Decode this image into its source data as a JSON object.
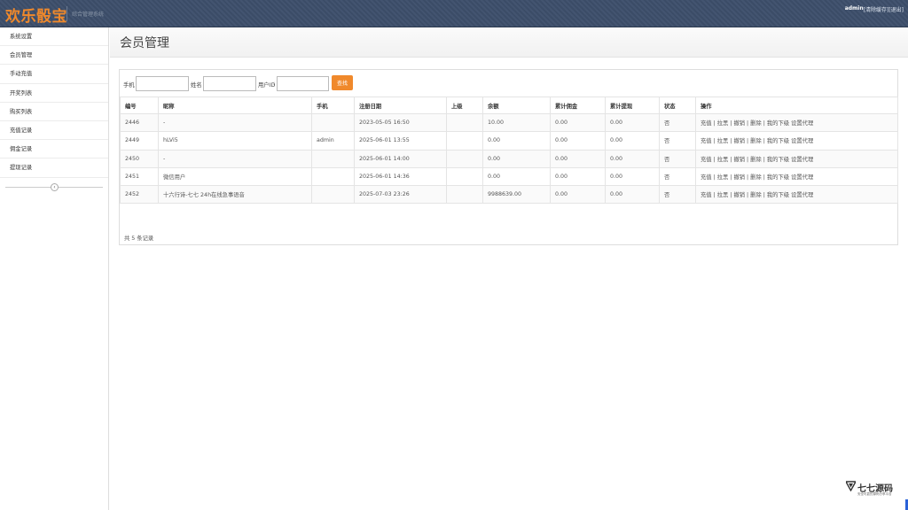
{
  "header": {
    "logo": "欢乐骰宝",
    "subtitle": "综合管理系统",
    "user": "admin",
    "clear_cache": "[清除缓存]",
    "logout": "[退出]"
  },
  "sidebar": {
    "items": [
      {
        "label": "系统设置"
      },
      {
        "label": "会员管理"
      },
      {
        "label": "手动充值"
      },
      {
        "label": "开奖列表"
      },
      {
        "label": "购买列表"
      },
      {
        "label": "充值记录"
      },
      {
        "label": "佣金记录"
      },
      {
        "label": "提现记录"
      }
    ],
    "collapse_icon": "chevron-left-icon"
  },
  "main": {
    "title": "会员管理",
    "search": {
      "phone_label": "手机",
      "name_label": "姓名",
      "uid_label": "用户ID",
      "button_label": "查找",
      "button_color": "#f0892b"
    },
    "table": {
      "headers": [
        "编号",
        "昵称",
        "手机",
        "注册日期",
        "上级",
        "余额",
        "累计佣金",
        "累计提现",
        "状态",
        "操作"
      ],
      "rows": [
        {
          "id": "2446",
          "nick": "-",
          "phone": "",
          "date": "2023-05-05 16:50",
          "parent": "",
          "balance": "10.00",
          "commission": "0.00",
          "withdraw": "0.00",
          "status": "否"
        },
        {
          "id": "2449",
          "nick": "hLVi5",
          "phone": "admin",
          "date": "2025-06-01 13:55",
          "parent": "",
          "balance": "0.00",
          "commission": "0.00",
          "withdraw": "0.00",
          "status": "否"
        },
        {
          "id": "2450",
          "nick": "-",
          "phone": "",
          "date": "2025-06-01 14:00",
          "parent": "",
          "balance": "0.00",
          "commission": "0.00",
          "withdraw": "0.00",
          "status": "否"
        },
        {
          "id": "2451",
          "nick": "微信用户",
          "phone": "",
          "date": "2025-06-01 14:36",
          "parent": "",
          "balance": "0.00",
          "commission": "0.00",
          "withdraw": "0.00",
          "status": "否"
        },
        {
          "id": "2452",
          "nick": "十六行诗-七七 24h在线急事语音",
          "phone": "",
          "date": "2025-07-03 23:26",
          "parent": "",
          "balance": "9988639.00",
          "commission": "0.00",
          "withdraw": "0.00",
          "status": "否"
        }
      ],
      "ops": [
        "充值",
        "拉黑",
        "撤销",
        "删除",
        "我的下级",
        "设置代理"
      ],
      "total": "共 5 条记录"
    }
  },
  "brand": {
    "name": "七七源码",
    "sub": "安全可靠的源码分享平台"
  },
  "colors": {
    "header_bg": "#3d4f6b",
    "logo": "#f0892b",
    "accent": "#f0892b"
  }
}
